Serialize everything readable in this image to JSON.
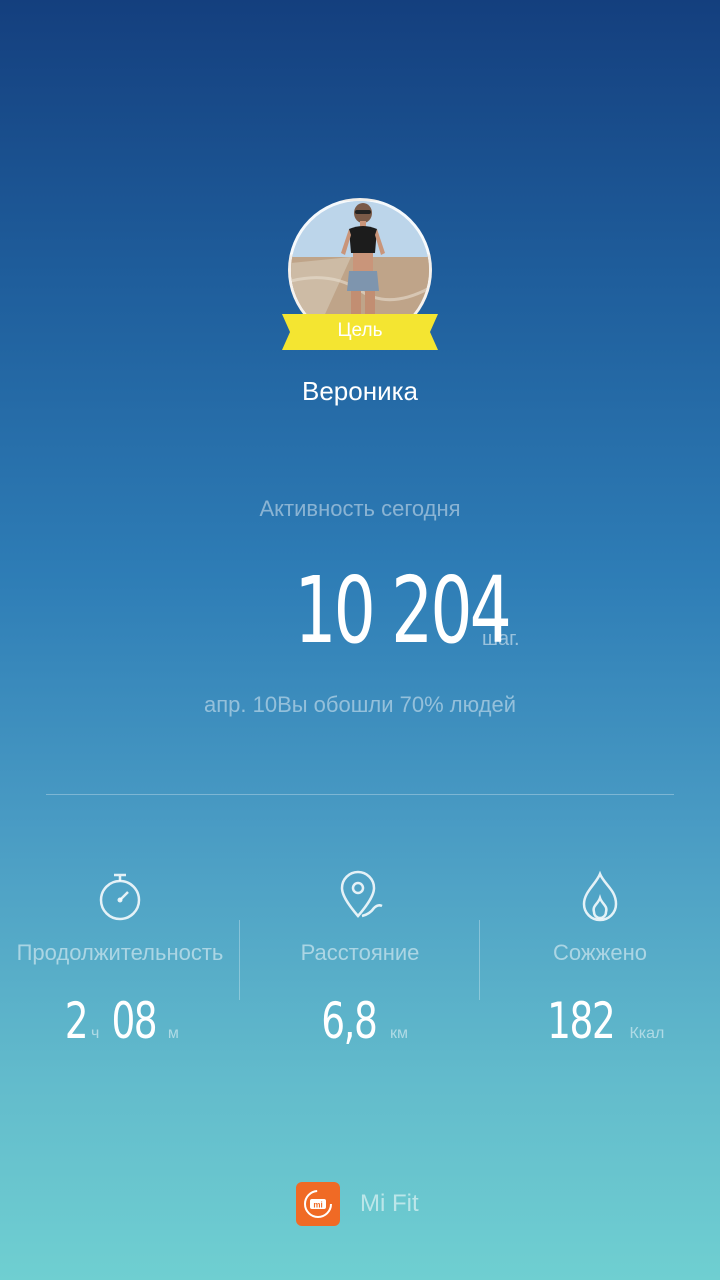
{
  "profile": {
    "goal_ribbon": "Цель",
    "name": "Вероника"
  },
  "activity": {
    "label": "Активность сегодня",
    "steps": "10 204",
    "steps_unit": "шаг.",
    "comparison": "апр. 10Вы обошли 70% людей"
  },
  "stats": {
    "duration": {
      "label": "Продолжительность",
      "hours": "2",
      "hours_unit": "ч",
      "minutes": "08",
      "minutes_unit": "м",
      "icon": "stopwatch-icon"
    },
    "distance": {
      "label": "Расстояние",
      "value": "6,8",
      "unit": "км",
      "icon": "location-pin-icon"
    },
    "burned": {
      "label": "Сожжено",
      "value": "182",
      "unit": "Ккал",
      "icon": "flame-icon"
    }
  },
  "brand": {
    "name": "Mi Fit",
    "logo_text": "mi",
    "logo_color": "#f06a25"
  },
  "colors": {
    "ribbon": "#f4e531",
    "background_top": "#143f7e",
    "background_bottom": "#6fcfd1"
  }
}
